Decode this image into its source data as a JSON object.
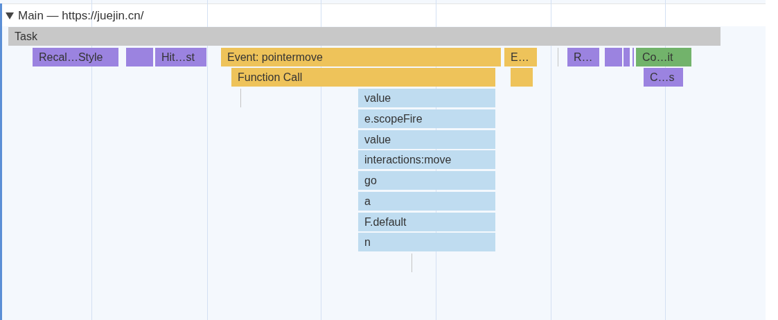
{
  "track": {
    "title": "Main — https://juejin.cn/",
    "expanded": true
  },
  "rows": [
    [
      {
        "kind": "task",
        "label": "Task"
      }
    ],
    [
      {
        "kind": "rendering",
        "label": "Recal…Style"
      },
      {
        "kind": "rendering"
      },
      {
        "kind": "rendering",
        "label": "Hit…st"
      },
      {
        "kind": "scripting",
        "label": "Event: pointermove"
      },
      {
        "kind": "scripting",
        "label": "E…"
      },
      {
        "kind": "tick"
      },
      {
        "kind": "rendering",
        "label": "R…"
      },
      {
        "kind": "rendering"
      },
      {
        "kind": "rendering"
      },
      {
        "kind": "rendering"
      },
      {
        "kind": "painting",
        "label": "Co…it"
      }
    ],
    [
      {
        "kind": "scripting",
        "label": "Function Call"
      },
      {
        "kind": "scripting"
      },
      {
        "kind": "rendering",
        "label": "C…s"
      }
    ],
    [
      {
        "kind": "tick"
      },
      {
        "kind": "function",
        "label": "value"
      }
    ],
    [
      {
        "kind": "function",
        "label": "e.scopeFire"
      }
    ],
    [
      {
        "kind": "function",
        "label": "value"
      }
    ],
    [
      {
        "kind": "function",
        "label": "interactions:move"
      }
    ],
    [
      {
        "kind": "function",
        "label": "go"
      }
    ],
    [
      {
        "kind": "function",
        "label": "a"
      }
    ],
    [
      {
        "kind": "function",
        "label": "F.default"
      }
    ],
    [
      {
        "kind": "function",
        "label": "n"
      }
    ],
    [
      {
        "kind": "tick"
      }
    ]
  ]
}
